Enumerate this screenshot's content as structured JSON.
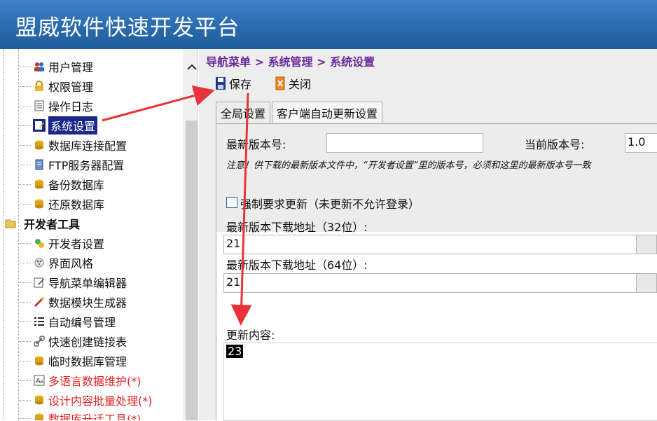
{
  "app": {
    "title": "盟威软件快速开发平台"
  },
  "sidebar": {
    "items": [
      {
        "label": "用户管理",
        "icon": "users-icon"
      },
      {
        "label": "权限管理",
        "icon": "lock-icon"
      },
      {
        "label": "操作日志",
        "icon": "log-icon"
      },
      {
        "label": "系统设置",
        "icon": "settings-icon"
      },
      {
        "label": "数据库连接配置",
        "icon": "database-icon"
      },
      {
        "label": "FTP服务器配置",
        "icon": "server-icon"
      },
      {
        "label": "备份数据库",
        "icon": "backup-icon"
      },
      {
        "label": "还原数据库",
        "icon": "restore-icon"
      }
    ],
    "group": {
      "label": "开发者工具",
      "icon": "folder-open-icon"
    },
    "dev_items": [
      {
        "label": "开发者设置",
        "icon": "dev-settings-icon"
      },
      {
        "label": "界面风格",
        "icon": "palette-icon"
      },
      {
        "label": "导航菜单编辑器",
        "icon": "menu-editor-icon"
      },
      {
        "label": "数据模块生成器",
        "icon": "generator-icon"
      },
      {
        "label": "自动编号管理",
        "icon": "numbered-list-icon"
      },
      {
        "label": "快速创建链接表",
        "icon": "link-icon"
      },
      {
        "label": "临时数据库管理",
        "icon": "database-icon"
      },
      {
        "label": "多语言数据维护(*)",
        "icon": "language-icon"
      },
      {
        "label": "设计内容批量处理(*)",
        "icon": "batch-icon"
      },
      {
        "label": "数据库升迁工具(*)",
        "icon": "upgrade-icon"
      }
    ]
  },
  "main": {
    "breadcrumb": "导航菜单 > 系统管理 > 系统设置",
    "toolbar": {
      "save_label": "保存",
      "close_label": "关闭"
    },
    "tabs": [
      {
        "label": "全局设置"
      },
      {
        "label": "客户端自动更新设置"
      }
    ],
    "form": {
      "latest_version_label": "最新版本号:",
      "latest_version_value": "",
      "current_version_label": "当前版本号:",
      "current_version_value": "1.0",
      "note": "注意！供下载的最新版本文件中，“开发者设置”里的版本号，必须和这里的最新版本号一致",
      "force_update_label": "强制要求更新（未更新不允许登录）",
      "url32_label": "最新版本下载地址（32位）:",
      "url32_value": "21",
      "url64_label": "最新版本下载地址（64位）:",
      "url64_value": "21",
      "update_content_label": "更新内容:",
      "update_content_value": "23"
    }
  },
  "colors": {
    "header": "#2d6fb2",
    "breadcrumb": "#6a2a9a",
    "selected": "#1a2a8a",
    "red_item": "#e52222",
    "arrow": "#e8333a"
  }
}
